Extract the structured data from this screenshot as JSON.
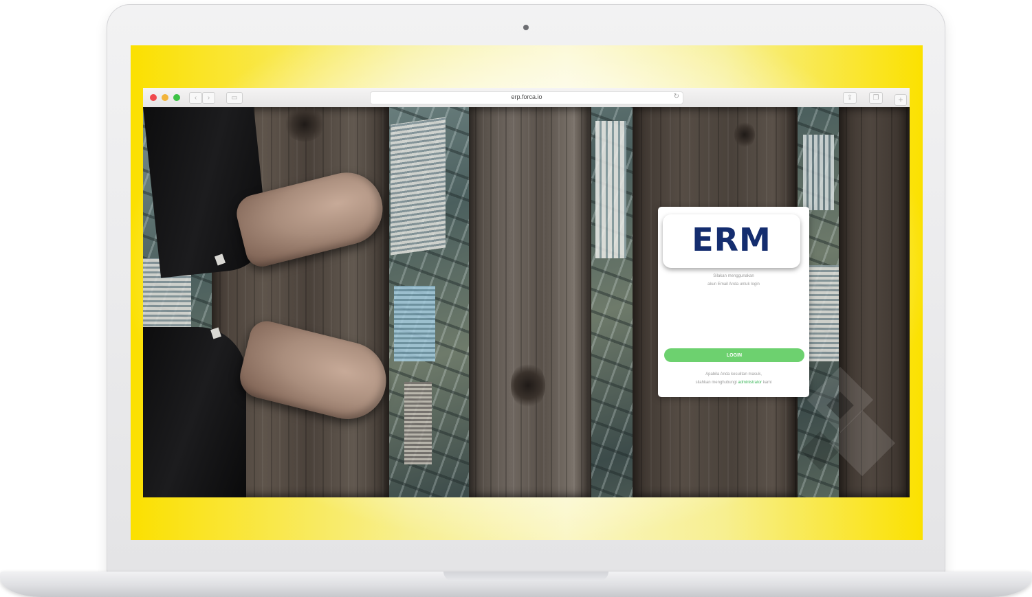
{
  "browser": {
    "url": "erp.forca.io",
    "icons": {
      "back": "chevron-left-icon",
      "forward": "chevron-right-icon",
      "sidebar": "sidebar-icon",
      "reload": "reload-icon",
      "share": "share-icon",
      "tabs": "tabs-icon",
      "new_tab": "plus-icon"
    },
    "colors": {
      "close": "#f0494c",
      "minimize": "#f2b43a",
      "maximize": "#3cc244"
    }
  },
  "login": {
    "logo_text": "ERM",
    "subtitle_line1": "Silakan menggunakan",
    "subtitle_line2": "akun Email Anda untuk login",
    "login_button": "LOGIN",
    "footer_line1": "Apabila Anda kesulitan masuk,",
    "footer_prefix": "silahkan menghubungi ",
    "footer_link": "administrator",
    "footer_suffix": " kami",
    "colors": {
      "logo": "#142d6f",
      "button": "#6dd16f",
      "link": "#3fb85c"
    }
  }
}
